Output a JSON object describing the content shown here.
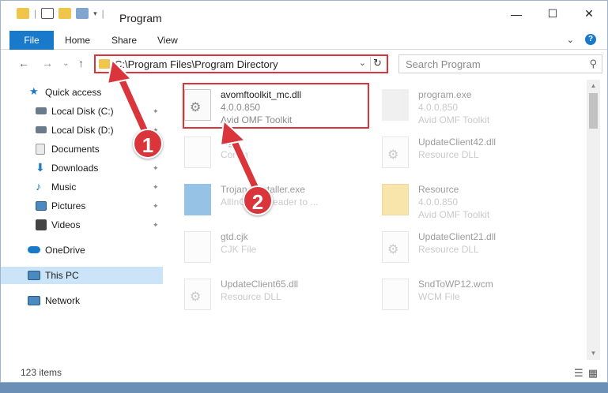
{
  "window": {
    "title": "Program",
    "min_glyph": "—",
    "max_glyph": "☐",
    "close_glyph": "✕"
  },
  "ribbon": {
    "tabs": [
      "File",
      "Home",
      "Share",
      "View"
    ],
    "expand_glyph": "⌄",
    "help_glyph": "?"
  },
  "nav": {
    "back_glyph": "←",
    "forward_glyph": "→",
    "recent_glyph": "⌄",
    "up_glyph": "↑",
    "address": "C:\\Program Files\\Program Directory",
    "address_dd_glyph": "⌄",
    "refresh_glyph": "↻",
    "search_placeholder": "Search Program",
    "search_glyph": "⚲"
  },
  "sidebar": {
    "items": [
      {
        "label": "Quick access",
        "icon": "star-icon",
        "color": "#1979ca",
        "pinned": false
      },
      {
        "label": "Local Disk (C:)",
        "icon": "drive-icon",
        "color": "#6a7b8c",
        "pinned": true
      },
      {
        "label": "Local Disk (D:)",
        "icon": "drive-icon",
        "color": "#6a7b8c",
        "pinned": true
      },
      {
        "label": "Documents",
        "icon": "documents-icon",
        "color": "#8a8a8a",
        "pinned": true
      },
      {
        "label": "Downloads",
        "icon": "download-icon",
        "color": "#1979ca",
        "pinned": true
      },
      {
        "label": "Music",
        "icon": "music-icon",
        "color": "#1979ca",
        "pinned": true
      },
      {
        "label": "Pictures",
        "icon": "pictures-icon",
        "color": "#4a8ac0",
        "pinned": true
      },
      {
        "label": "Videos",
        "icon": "videos-icon",
        "color": "#444444",
        "pinned": true
      },
      {
        "label": "OneDrive",
        "icon": "cloud-icon",
        "color": "#1979ca",
        "pinned": false
      },
      {
        "label": "This PC",
        "icon": "computer-icon",
        "color": "#4a8ac0",
        "pinned": false,
        "selected": true
      },
      {
        "label": "Network",
        "icon": "network-icon",
        "color": "#4a8ac0",
        "pinned": false
      }
    ],
    "pin_glyph": "📌"
  },
  "files": [
    {
      "name": "avomftoolkit_mc.dll",
      "line2": "4.0.0.850",
      "line3": "Avid OMF Toolkit",
      "icon": "dll-gear-icon",
      "highlighted": true
    },
    {
      "name": "program.exe",
      "line2": "4.0.0.850",
      "line3": "Avid OMF Toolkit",
      "icon": "exe-icon",
      "highlighted": false
    },
    {
      "name": "cfg",
      "line2": "Config",
      "line3": "",
      "icon": "file-icon",
      "highlighted": false
    },
    {
      "name": "UpdateClient42.dll",
      "line2": "Resource DLL",
      "line3": "",
      "icon": "dll-gear-icon",
      "highlighted": false
    },
    {
      "name": "Trojan...installer.exe",
      "line2": "AllInOne... header to ...",
      "line3": "",
      "icon": "installer-icon",
      "highlighted": false
    },
    {
      "name": "Resource",
      "line2": "4.0.0.850",
      "line3": "Avid OMF Toolkit",
      "icon": "folder-icon",
      "highlighted": false
    },
    {
      "name": "gtd.cjk",
      "line2": "CJK File",
      "line3": "",
      "icon": "file-icon",
      "highlighted": false
    },
    {
      "name": "UpdateClient21.dll",
      "line2": "Resource DLL",
      "line3": "",
      "icon": "dll-gear-icon",
      "highlighted": false
    },
    {
      "name": "UpdateClient65.dll",
      "line2": "Resource DLL",
      "line3": "",
      "icon": "dll-gear-icon",
      "highlighted": false
    },
    {
      "name": "SndToWP12.wcm",
      "line2": "WCM File",
      "line3": "",
      "icon": "file-icon",
      "highlighted": false
    }
  ],
  "status": {
    "items_count": "123 items",
    "details_view_glyph": "☰",
    "tiles_view_glyph": "▦"
  },
  "callouts": [
    {
      "label": "1"
    },
    {
      "label": "2"
    }
  ],
  "colors": {
    "accent": "#1979ca",
    "highlight": "#d9353a",
    "selection": "#cce4f7"
  }
}
